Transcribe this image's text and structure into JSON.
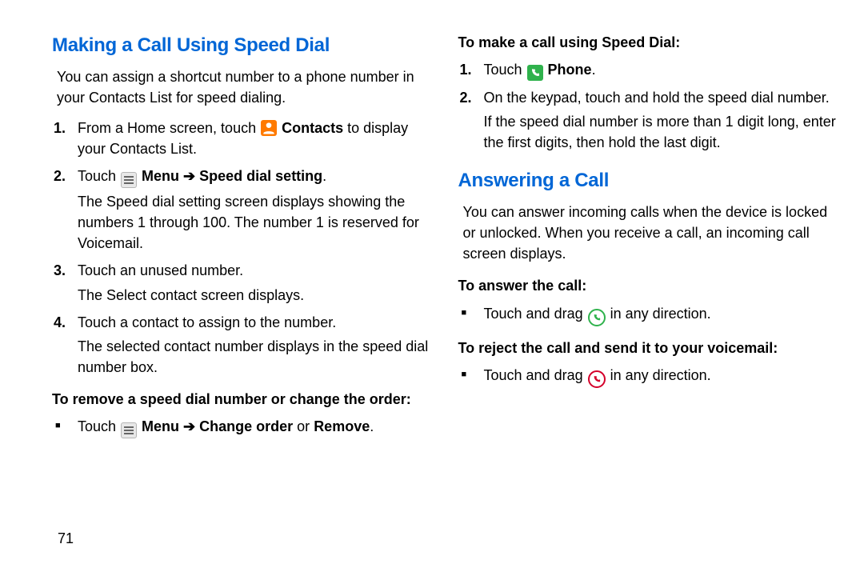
{
  "page_number": "71",
  "left": {
    "heading": "Making a Call Using Speed Dial",
    "intro": "You can assign a shortcut number to a phone number in your Contacts List for speed dialing.",
    "steps": [
      {
        "num": "1.",
        "pre": "From a Home screen, touch ",
        "icon": "contacts",
        "bold_after_icon": " Contacts",
        "post": " to display your Contacts List."
      },
      {
        "num": "2.",
        "pre": "Touch ",
        "icon": "menu",
        "bold_after_icon": " Menu ",
        "arrow": "➔",
        "bold_after_arrow": " Speed dial setting",
        "post": ".",
        "sub": "The Speed dial setting screen displays showing the numbers 1 through 100. The number 1 is reserved for Voicemail."
      },
      {
        "num": "3.",
        "text": "Touch an unused number.",
        "sub": "The Select contact screen displays."
      },
      {
        "num": "4.",
        "text": "Touch a contact to assign to the number.",
        "sub": "The selected contact number displays in the speed dial number box."
      }
    ],
    "sub1_head": "To remove a speed dial number or change the order:",
    "sub1_bullet": {
      "pre": "Touch ",
      "icon": "menu",
      "bold_after_icon": " Menu ",
      "arrow": "➔",
      "bold_after_arrow": " Change order",
      "mid": " or ",
      "bold_end": "Remove",
      "post": "."
    }
  },
  "right": {
    "sub_head": "To make a call using Speed Dial:",
    "steps": [
      {
        "num": "1.",
        "pre": "Touch ",
        "icon": "phone",
        "bold_after_icon": " Phone",
        "post": "."
      },
      {
        "num": "2.",
        "text": "On the keypad, touch and hold the speed dial number.",
        "sub": "If the speed dial number is more than 1 digit long, enter the first digits, then hold the last digit."
      }
    ],
    "heading2": "Answering a Call",
    "intro2": "You can answer incoming calls when the device is locked or unlocked. When you receive a call, an incoming call screen displays.",
    "answer_head": "To answer the call:",
    "answer_bullet": {
      "pre": "Touch and drag ",
      "icon": "answer",
      "post": " in any direction."
    },
    "reject_head": "To reject the call and send it to your voicemail:",
    "reject_bullet": {
      "pre": "Touch and drag ",
      "icon": "reject",
      "post": " in any direction."
    }
  }
}
